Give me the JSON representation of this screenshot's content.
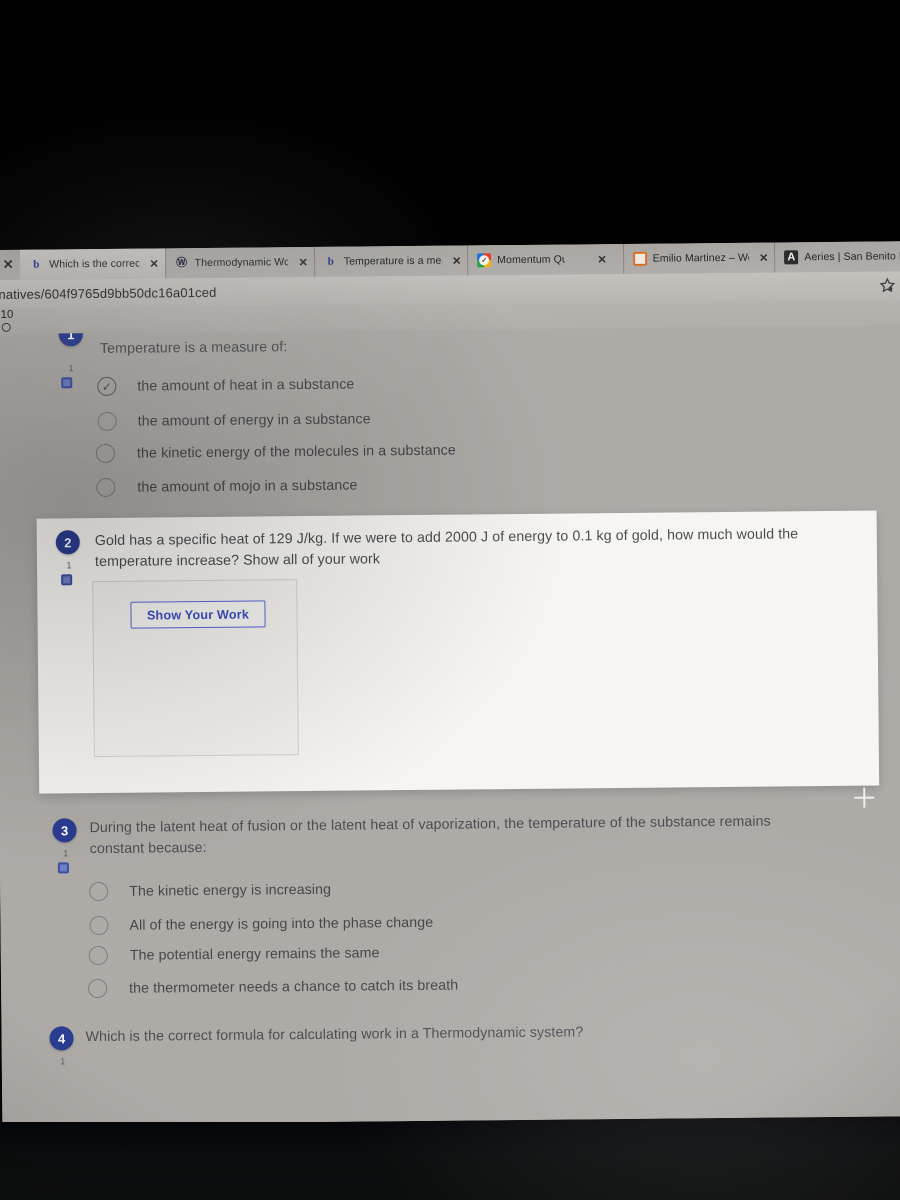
{
  "browser": {
    "leading_close_label": "✕",
    "tabs": [
      {
        "title": "Which is the correct f",
        "favicon": "b-logo-icon",
        "close_label": "✕",
        "active": true
      },
      {
        "title": "Thermodynamic Work",
        "favicon": "w-logo-icon",
        "close_label": "✕",
        "active": false
      },
      {
        "title": "Temperature is a meas",
        "favicon": "b-logo-icon",
        "close_label": "✕",
        "active": false
      },
      {
        "title": "Momentum Quiz",
        "favicon": "quiz-check-icon",
        "close_label": "✕",
        "active": false
      },
      {
        "title": "Emilio Martinez – Wee",
        "favicon": "orange-square-icon",
        "close_label": "✕",
        "active": false
      },
      {
        "title": "Aeries | San Benito Hi",
        "favicon": "aeries-icon",
        "close_label": "",
        "active": false
      }
    ],
    "address_bar": {
      "url": "natives/604f9765d9bb50dc16a01ced"
    },
    "favorites_icon": "star-favorite-icon",
    "bookmark_bar": {
      "number": "10",
      "circle_icon": "circle-icon"
    }
  },
  "quiz": {
    "questions": [
      {
        "number": "1",
        "points": "1",
        "flag_icon": "flag-marker-icon",
        "text": "Temperature is a measure of:",
        "options": [
          {
            "label": "the amount of heat in a substance",
            "selected": true
          },
          {
            "label": "the amount of energy in a substance",
            "selected": false
          },
          {
            "label": "the kinetic energy of the molecules in a substance",
            "selected": false
          },
          {
            "label": "the amount of mojo in a substance",
            "selected": false
          }
        ]
      },
      {
        "number": "2",
        "points": "1",
        "flag_icon": "flag-marker-icon",
        "text_line1": "Gold has a specific heat of 129 J/kg.  If we were to add 2000 J of energy to 0.1 kg of gold, how much would the",
        "text_line2": "temperature increase?  Show all of your work",
        "show_work_button": "Show Your Work"
      },
      {
        "number": "3",
        "points": "1",
        "flag_icon": "flag-marker-icon",
        "text_line1": "During the latent heat of fusion or the latent heat of vaporization, the temperature of the substance remains",
        "text_line2": "constant because:",
        "options": [
          {
            "label": "The kinetic energy is increasing",
            "selected": false
          },
          {
            "label": "All of the energy is going into the phase change",
            "selected": false
          },
          {
            "label": "The potential energy remains the same",
            "selected": false
          },
          {
            "label": "the thermometer needs a chance to catch its breath",
            "selected": false
          }
        ]
      },
      {
        "number": "4",
        "points": "1",
        "flag_icon": "flag-marker-icon",
        "text": "Which is the correct formula for calculating work in a Thermodynamic system?"
      }
    ]
  },
  "taskbar": {
    "items": [
      {
        "name": "search-circle-icon",
        "glyph": "○"
      },
      {
        "name": "task-view-icon",
        "glyph": "❑↑"
      },
      {
        "name": "edge-browser-icon",
        "glyph": ""
      },
      {
        "name": "file-explorer-icon",
        "glyph": ""
      },
      {
        "name": "microsoft-store-icon",
        "glyph": ""
      },
      {
        "name": "mail-icon",
        "glyph": ""
      },
      {
        "name": "office-app-icon",
        "glyph": ""
      }
    ]
  },
  "colors": {
    "accent_blue": "#2a3c91",
    "button_blue": "#3d4fc4",
    "card_bg": "#f7f5f1",
    "page_bg": "#aeaba7"
  }
}
